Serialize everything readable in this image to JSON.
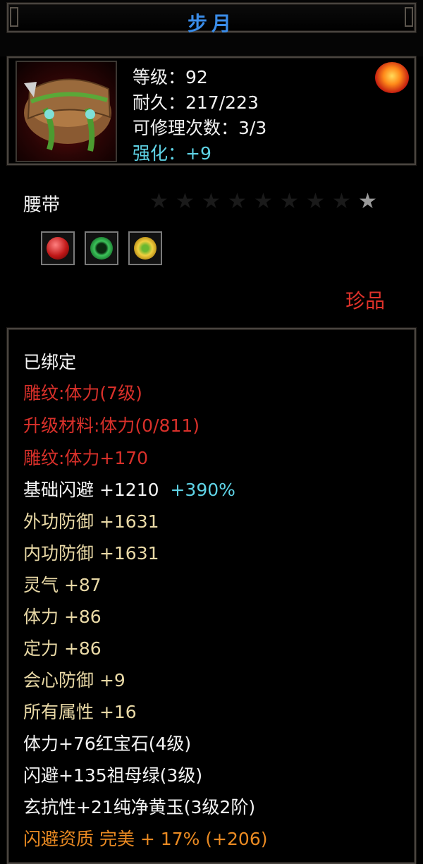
{
  "title": "步月",
  "item": {
    "level": "等级：92",
    "durability": "耐久：217/223",
    "repairs": "可修理次数：3/3",
    "enhance": "强化：+9",
    "type": "腰带",
    "stars": {
      "lit": 1,
      "total": 9
    },
    "quality": "珍品",
    "icon": "belt-icon"
  },
  "gems": [
    {
      "icon": "ruby-gem-icon",
      "color": "#d42020"
    },
    {
      "icon": "emerald-ring-icon",
      "color": "#2fa84a"
    },
    {
      "icon": "jade-gold-icon",
      "color": "#e8b820"
    }
  ],
  "attributes": {
    "bound": "已绑定",
    "engrave1": "雕纹:体力(7级)",
    "upgrade": "升级材料:体力(0/811)",
    "engrave2": "雕纹:体力+170",
    "dodge_base": "基础闪避 +1210",
    "dodge_pct": "+390%",
    "outer_def": "外功防御 +1631",
    "inner_def": "内功防御 +1631",
    "spirit": "灵气 +87",
    "stamina": "体力 +86",
    "focus": "定力 +86",
    "crit_def": "会心防御 +9",
    "all_attr": "所有属性 +16",
    "gem1": "体力+76红宝石(4级)",
    "gem2": "闪避+135祖母绿(3级)",
    "gem3": "玄抗性+21纯净黄玉(3级2阶)",
    "aptitude": "闪避资质 完美 + 17% (+206)"
  }
}
